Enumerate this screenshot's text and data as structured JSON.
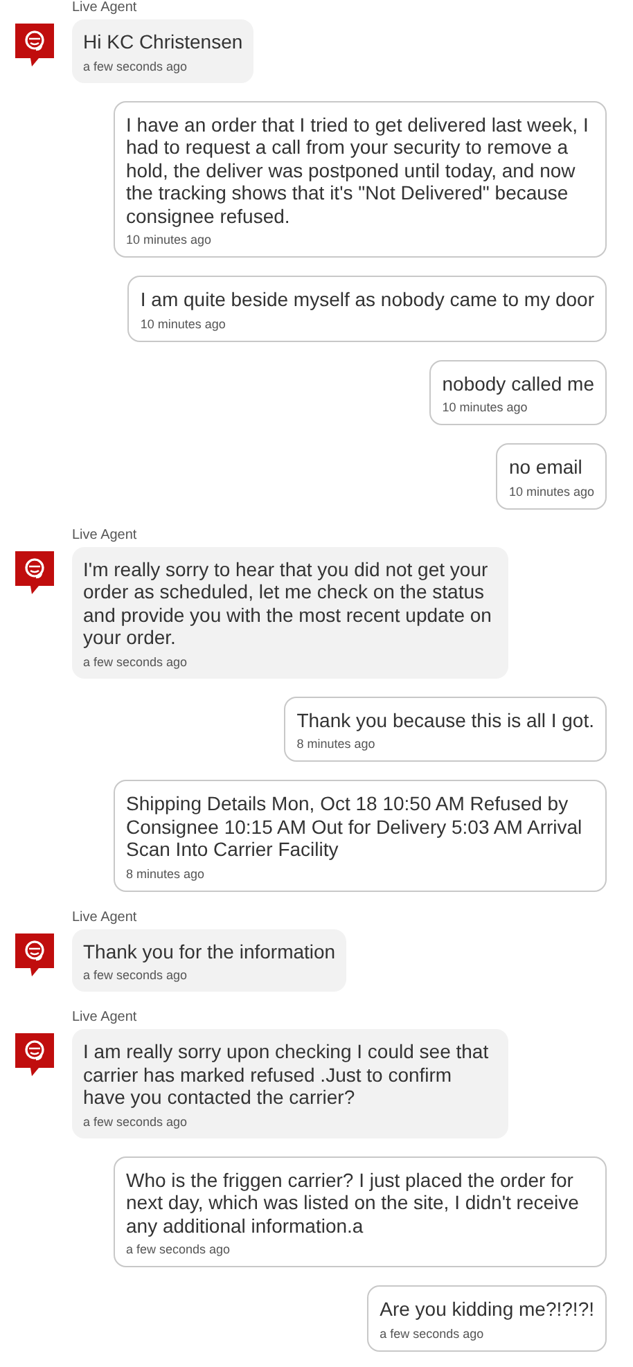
{
  "messages": [
    {
      "kind": "agent",
      "sender": "Live Agent",
      "text": "Hi KC Christensen",
      "time": "a few seconds ago"
    },
    {
      "kind": "user",
      "text": "I have an order that I tried to get delivered last week, I had to request a call from your security to remove a hold, the deliver was postponed until today, and now the tracking shows that it's \"Not Delivered\" because consignee refused.",
      "time": "10 minutes ago"
    },
    {
      "kind": "user",
      "text": "I am quite beside myself as nobody came to my door",
      "time": "10 minutes ago"
    },
    {
      "kind": "user",
      "text": "nobody called me",
      "time": "10 minutes ago"
    },
    {
      "kind": "user",
      "text": "no email",
      "time": "10 minutes ago"
    },
    {
      "kind": "agent",
      "sender": "Live Agent",
      "text": "I'm really sorry to hear that you did not get your order as scheduled, let me check on the status and provide you with the most recent update on your order.",
      "time": "a few seconds ago"
    },
    {
      "kind": "user",
      "text": "Thank you because this is all I got.",
      "time": "8 minutes ago"
    },
    {
      "kind": "user",
      "text": "Shipping Details Mon, Oct 18 10:50 AM Refused by Consignee 10:15 AM Out for Delivery 5:03 AM Arrival Scan Into Carrier Facility",
      "time": "8 minutes ago"
    },
    {
      "kind": "agent",
      "sender": "Live Agent",
      "text": "Thank you for the information",
      "time": "a few seconds ago"
    },
    {
      "kind": "agent",
      "sender": "Live Agent",
      "text": "I am really sorry upon checking I could see that carrier has marked refused .Just to confirm have you contacted the carrier?",
      "time": "a few seconds ago"
    },
    {
      "kind": "user",
      "text": "Who is the friggen carrier? I just placed the order for next day, which was listed on the site, I didn't receive any additional information.a",
      "time": "a few seconds ago"
    },
    {
      "kind": "user",
      "text": "Are you kidding me?!?!?!",
      "time": "a few seconds ago"
    }
  ]
}
